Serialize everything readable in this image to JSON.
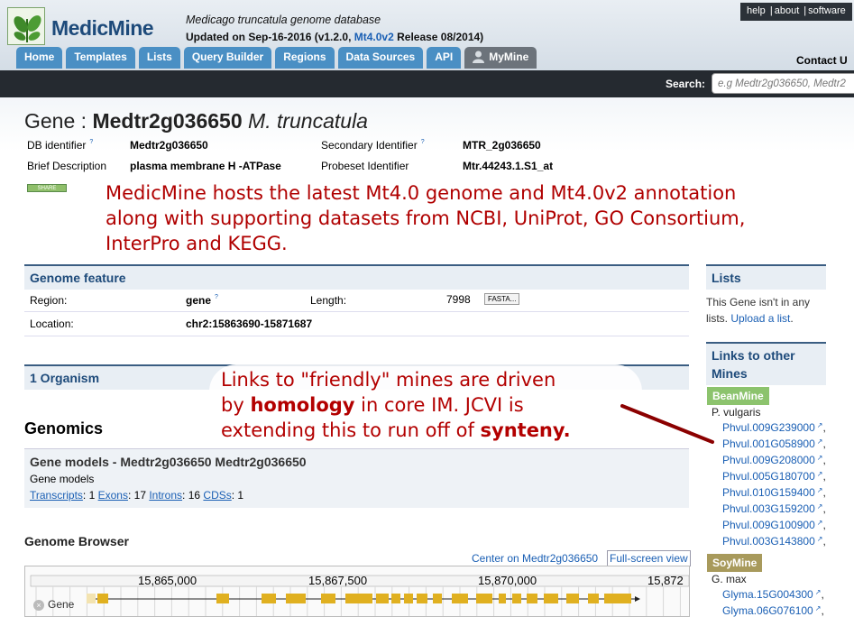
{
  "header": {
    "app_name": "MedicMine",
    "tagline": "Medicago truncatula genome database",
    "updated_prefix": "Updated on Sep-16-2016 (v1.2.0, ",
    "updated_link": "Mt4.0v2",
    "updated_suffix": " Release 08/2014)",
    "top_links": [
      "help",
      "about",
      "software"
    ],
    "contact": "Contact U",
    "tabs": [
      "Home",
      "Templates",
      "Lists",
      "Query Builder",
      "Regions",
      "Data Sources",
      "API"
    ],
    "mymine": "MyMine"
  },
  "search": {
    "label": "Search:",
    "placeholder": "e.g Medtr2g036650, Medtr2"
  },
  "gene": {
    "title_prefix": "Gene : ",
    "id": "Medtr2g036650",
    "organism": "M. truncatula",
    "db_identifier_label": "DB identifier",
    "db_identifier": "Medtr2g036650",
    "secondary_label": "Secondary Identifier",
    "secondary": "MTR_2g036650",
    "brief_label": "Brief Description",
    "brief": "plasma membrane H -ATPase",
    "probeset_label": "Probeset Identifier",
    "probeset": "Mtr.44243.1.S1_at",
    "share": "SHARE"
  },
  "callouts": {
    "c1": [
      "MedicMine hosts the latest Mt4.0 genome and Mt4.0v2 annotation",
      "along with supporting datasets from NCBI, UniProt, GO Consortium,",
      "InterPro and KEGG."
    ],
    "c2_line1": "Links to \"friendly\" mines are driven",
    "c2_line2_pre": "by ",
    "c2_line2_bold": "homology",
    "c2_line2_post": " in core IM. JCVI is",
    "c2_line3_pre": "extending this to run off of ",
    "c2_line3_bold": "synteny."
  },
  "genome_feature": {
    "heading": "Genome feature",
    "region_label": "Region:",
    "region": "gene",
    "length_label": "Length:",
    "length": "7998",
    "fasta": "FASTA...",
    "location_label": "Location:",
    "location": "chr2:15863690-15871687"
  },
  "organism_heading": "1 Organism",
  "genomics": {
    "heading": "Genomics",
    "models_title": "Gene models - Medtr2g036650 Medtr2g036650",
    "models_sub": "Gene models",
    "transcripts": "Transcripts",
    "transcripts_n": "1",
    "exons": "Exons",
    "exons_n": "17",
    "introns": "Introns",
    "introns_n": "16",
    "cdss": "CDSs",
    "cdss_n": "1"
  },
  "genome_browser": {
    "heading": "Genome Browser",
    "center_link": "Center on Medtr2g036650",
    "full_screen": "Full-screen view",
    "ticks": [
      "15,865,000",
      "15,867,500",
      "15,870,000",
      "15,872"
    ],
    "track_label": "Gene",
    "track_color": "#e0b020"
  },
  "sidebar": {
    "lists_heading": "Lists",
    "lists_text": "This Gene isn't in any lists. ",
    "lists_link": "Upload a list",
    "links_heading": "Links to other Mines",
    "beanmine": "BeanMine",
    "bean_org": "P. vulgaris",
    "bean_genes": [
      "Phvul.009G239000",
      "Phvul.001G058900",
      "Phvul.009G208000",
      "Phvul.005G180700",
      "Phvul.010G159400",
      "Phvul.003G159200",
      "Phvul.009G100900",
      "Phvul.003G143800"
    ],
    "soymine": "SoyMine",
    "soy_org": "G. max",
    "soy_genes": [
      "Glyma.15G004300",
      "Glyma.06G076100"
    ]
  }
}
